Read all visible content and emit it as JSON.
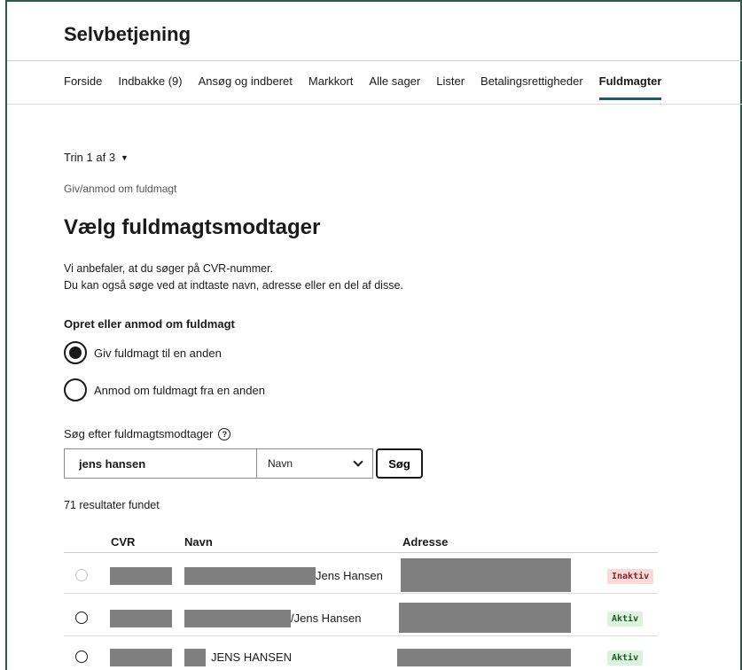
{
  "app": {
    "title": "Selvbetjening"
  },
  "nav": [
    {
      "label": "Forside",
      "active": false
    },
    {
      "label": "Indbakke (9)",
      "active": false
    },
    {
      "label": "Ansøg og indberet",
      "active": false
    },
    {
      "label": "Markkort",
      "active": false
    },
    {
      "label": "Alle sager",
      "active": false
    },
    {
      "label": "Lister",
      "active": false
    },
    {
      "label": "Betalingsrettigheder",
      "active": false
    },
    {
      "label": "Fuldmagter",
      "active": true
    }
  ],
  "step": {
    "label": "Trin 1 af 3"
  },
  "breadcrumb": "Giv/anmod om fuldmagt",
  "heading": "Vælg fuldmagtsmodtager",
  "intro": {
    "line1": "Vi anbefaler, at du søger på CVR-nummer.",
    "line2": "Du kan også søge ved at indtaste navn, adresse eller en del af disse."
  },
  "options": {
    "label": "Opret eller anmod om fuldmagt",
    "give": "Giv fuldmagt til en anden",
    "request": "Anmod om fuldmagt fra en anden",
    "selected": "give"
  },
  "search": {
    "label": "Søg efter fuldmagtsmodtager",
    "value": "jens hansen",
    "type_selected": "Navn",
    "button": "Søg"
  },
  "results": {
    "count_text": "71 resultater fundet",
    "columns": {
      "cvr": "CVR",
      "name": "Navn",
      "address": "Adresse"
    },
    "rows": [
      {
        "name_suffix": "Jens Hansen",
        "status": "Inaktiv",
        "status_kind": "inactive",
        "selectable": false
      },
      {
        "name_suffix": "/Jens Hansen",
        "status": "Aktiv",
        "status_kind": "active",
        "selectable": true
      },
      {
        "name_suffix": "JENS HANSEN",
        "status": "Aktiv",
        "status_kind": "active",
        "selectable": true
      }
    ]
  },
  "colors": {
    "nav_active_underline": "#1e5a6e",
    "badge_inactive_bg": "#f9dada",
    "badge_active_bg": "#ddf2dd",
    "redaction": "#7f7f7f"
  }
}
